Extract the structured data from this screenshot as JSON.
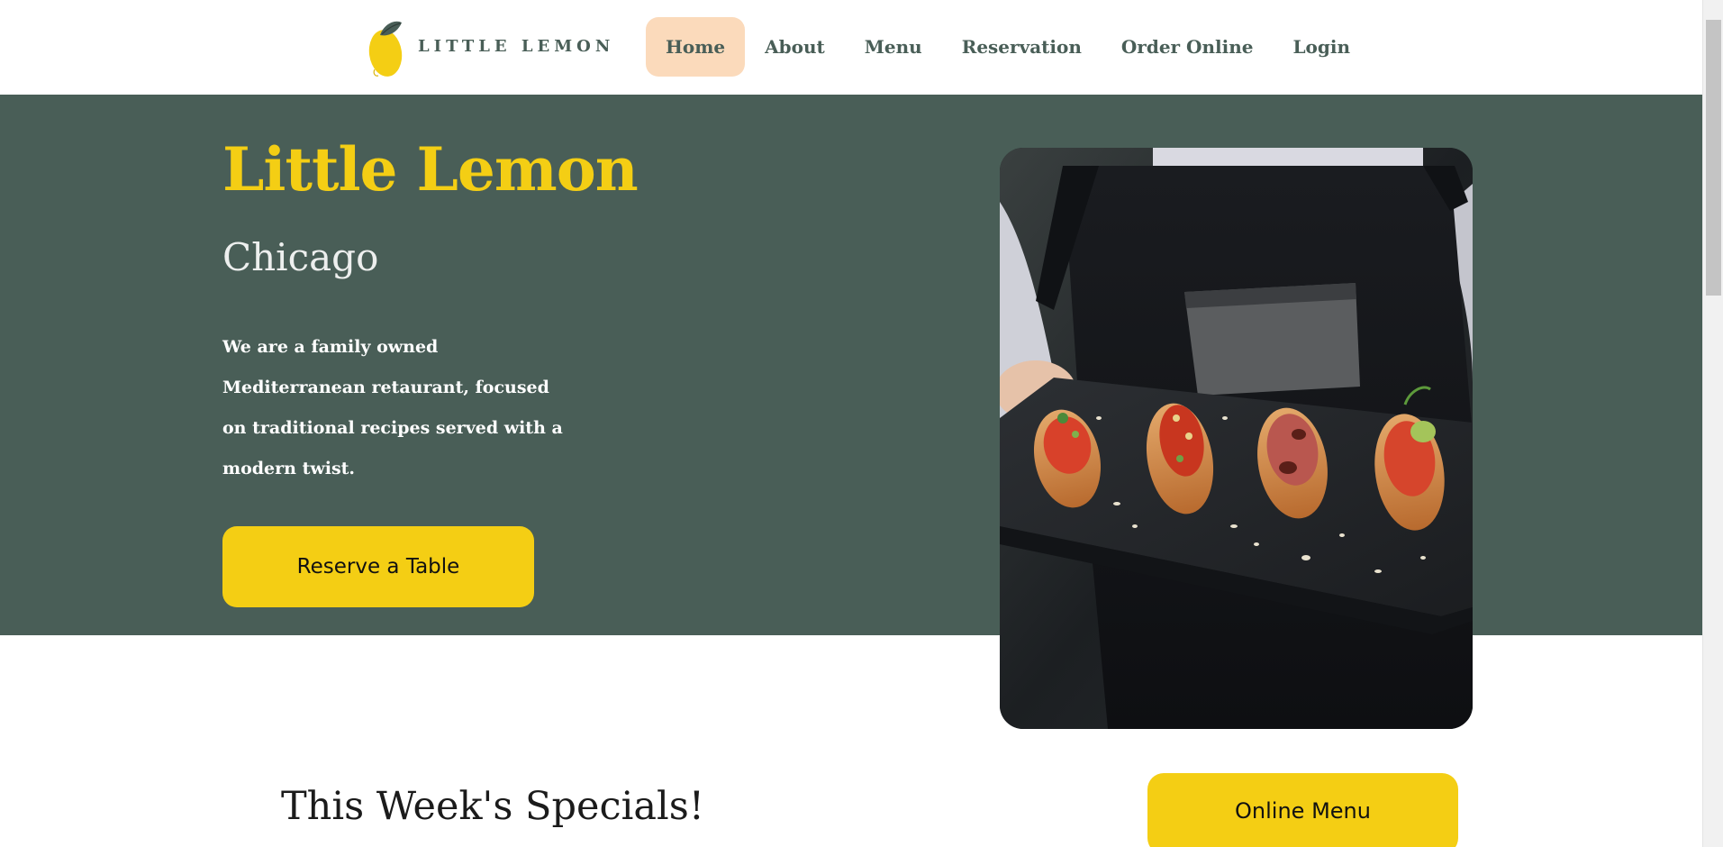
{
  "header": {
    "logo_text": "LITTLE LEMON",
    "nav": [
      {
        "label": "Home",
        "active": true
      },
      {
        "label": "About",
        "active": false
      },
      {
        "label": "Menu",
        "active": false
      },
      {
        "label": "Reservation",
        "active": false
      },
      {
        "label": "Order Online",
        "active": false
      },
      {
        "label": "Login",
        "active": false
      }
    ]
  },
  "hero": {
    "title": "Little Lemon",
    "subtitle": "Chicago",
    "description": "We are a family owned Mediterranean retaurant, focused on traditional recipes served with a modern twist.",
    "cta_label": "Reserve a Table"
  },
  "specials": {
    "title": "This Week's Specials!",
    "button_label": "Online Menu"
  },
  "colors": {
    "primary_green": "#495e57",
    "primary_yellow": "#f4ce14",
    "nav_active_bg": "#fbdabb",
    "highlight_white": "#edefee"
  },
  "icons": {
    "logo": "lemon-icon"
  }
}
